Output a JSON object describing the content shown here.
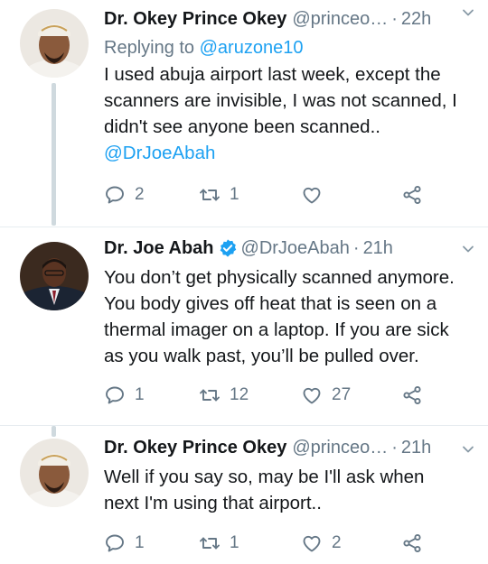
{
  "tweets": [
    {
      "name": "Dr. Okey Prince Okey",
      "handle": "@princeo…",
      "dot": "·",
      "time": "22h",
      "verified": false,
      "replying_prefix": "Replying to ",
      "replying_handle": "@aruzone10",
      "lines": [
        "I used abuja airport last week, except the",
        "scanners are invisible, I was not scanned, I",
        "didn't see anyone been scanned.."
      ],
      "mention": "@DrJoeAbah",
      "reply_count": "2",
      "retweet_count": "1",
      "like_count": ""
    },
    {
      "name": "Dr. Joe Abah",
      "handle": "@DrJoeAbah",
      "dot": "·",
      "time": "21h",
      "verified": true,
      "lines": [
        "You don’t get physically scanned anymore.",
        "You body gives off heat that is seen on a",
        "thermal imager on a laptop. If you are sick",
        "as you walk past, you’ll be pulled over."
      ],
      "reply_count": "1",
      "retweet_count": "12",
      "like_count": "27"
    },
    {
      "name": "Dr. Okey Prince Okey",
      "handle": "@princeo…",
      "dot": "·",
      "time": "21h",
      "verified": false,
      "lines": [
        "Well if you say so, may be I'll ask when",
        "next I'm using that airport.."
      ],
      "reply_count": "1",
      "retweet_count": "1",
      "like_count": "2"
    }
  ],
  "icons": [
    "reply-icon",
    "retweet-icon",
    "like-icon",
    "share-icon",
    "chevron-down-icon",
    "verified-badge-icon"
  ],
  "colors": {
    "link": "#1da1f2",
    "secondary": "#657786",
    "verified": "#1da1f2",
    "thread": "#cfd9de"
  }
}
